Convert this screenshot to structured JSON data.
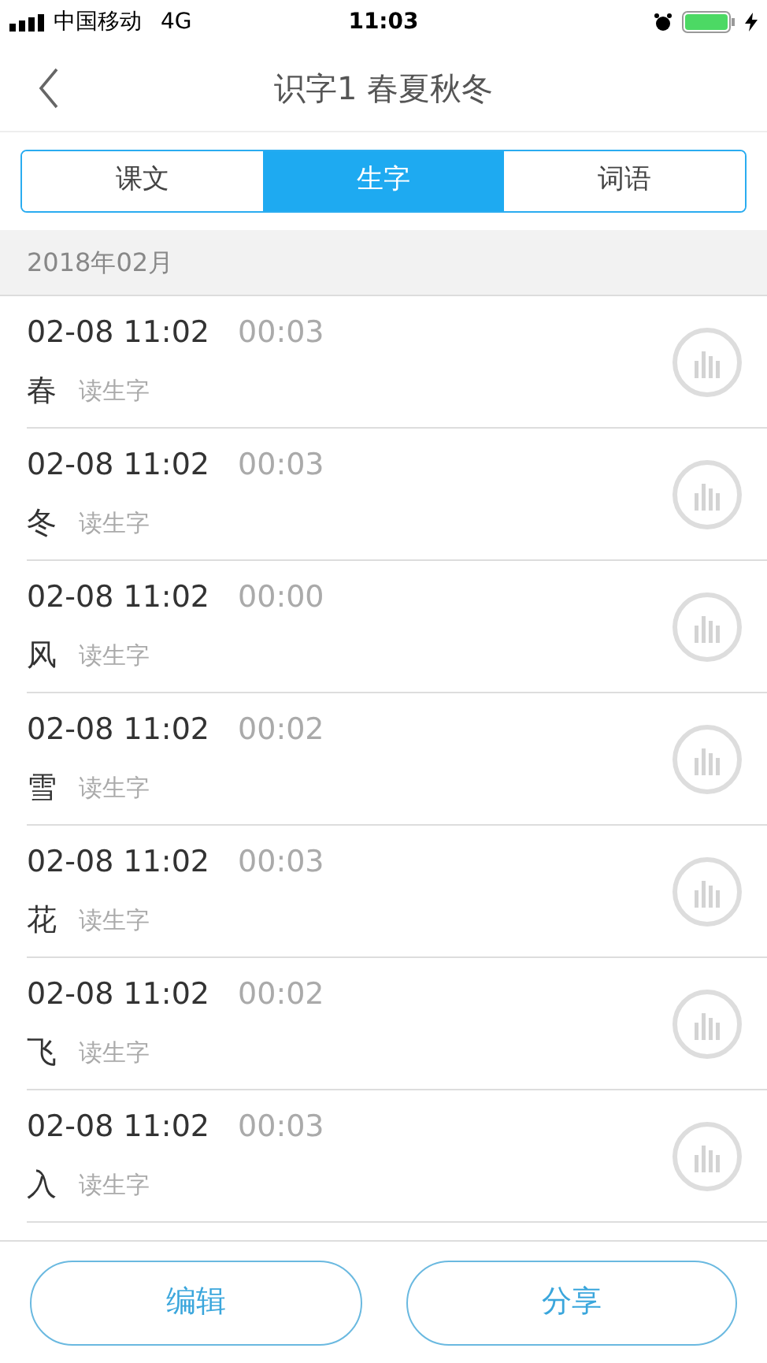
{
  "status_bar": {
    "carrier": "中国移动",
    "network": "4G",
    "time": "11:03"
  },
  "nav": {
    "title": "识字1 春夏秋冬"
  },
  "tabs": [
    {
      "label": "课文",
      "selected": false
    },
    {
      "label": "生字",
      "selected": true
    },
    {
      "label": "词语",
      "selected": false
    }
  ],
  "section": {
    "title": "2018年02月"
  },
  "recordings": [
    {
      "datetime": "02-08 11:02",
      "duration": "00:03",
      "character": "春",
      "label": "读生字"
    },
    {
      "datetime": "02-08 11:02",
      "duration": "00:03",
      "character": "冬",
      "label": "读生字"
    },
    {
      "datetime": "02-08 11:02",
      "duration": "00:00",
      "character": "风",
      "label": "读生字"
    },
    {
      "datetime": "02-08 11:02",
      "duration": "00:02",
      "character": "雪",
      "label": "读生字"
    },
    {
      "datetime": "02-08 11:02",
      "duration": "00:03",
      "character": "花",
      "label": "读生字"
    },
    {
      "datetime": "02-08 11:02",
      "duration": "00:02",
      "character": "飞",
      "label": "读生字"
    },
    {
      "datetime": "02-08 11:02",
      "duration": "00:03",
      "character": "入",
      "label": "读生字"
    }
  ],
  "footer": {
    "buttons": [
      "编辑",
      "分享"
    ]
  }
}
